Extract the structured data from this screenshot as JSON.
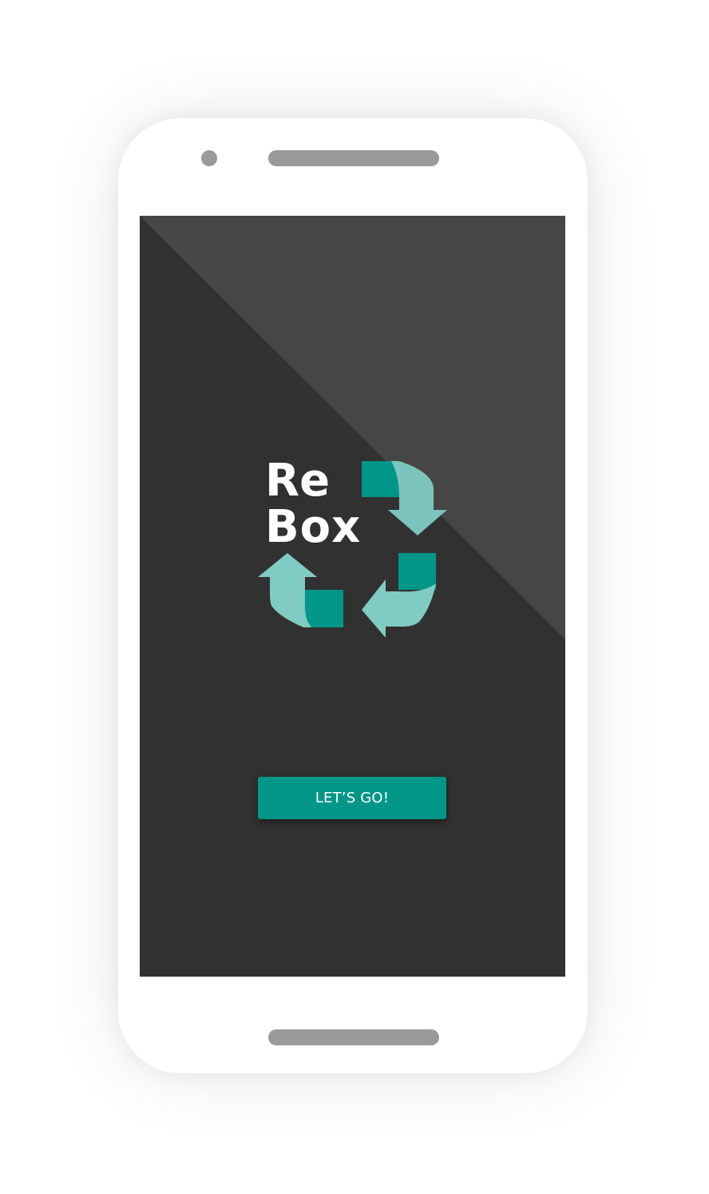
{
  "app": {
    "logo_text_line1": "Re",
    "logo_text_line2": "Box",
    "logo_icon": "recycle-arrows-icon",
    "cta_label": "LET’S GO!"
  },
  "colors": {
    "accent": "#009688",
    "accent_light": "#80cbc4",
    "background": "#313131",
    "background_highlight": "#464646"
  }
}
